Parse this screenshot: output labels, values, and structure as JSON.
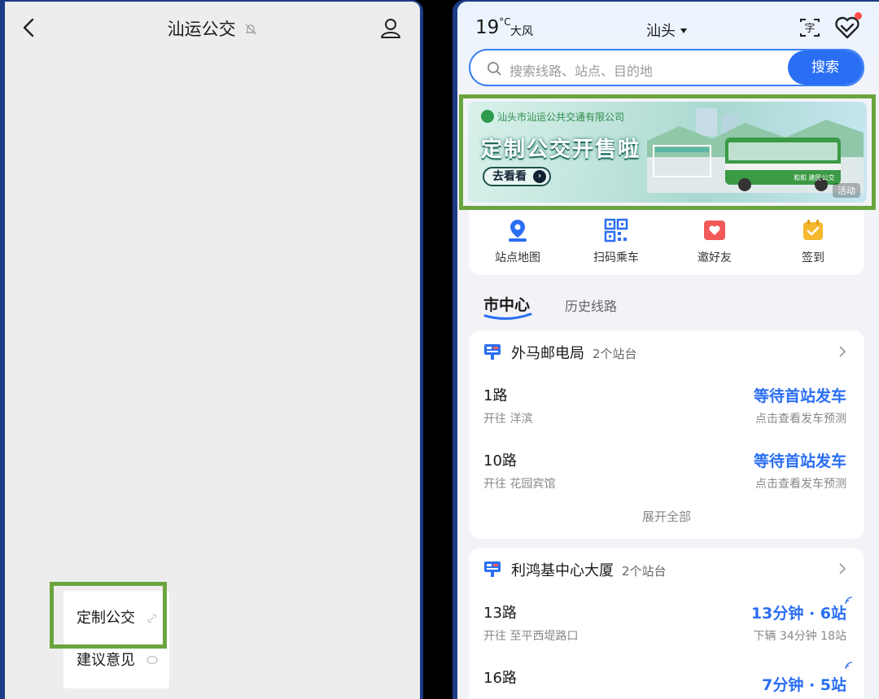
{
  "left": {
    "title": "汕运公交",
    "menu": [
      {
        "label": "定制公交"
      },
      {
        "label": "建议意见"
      }
    ]
  },
  "right": {
    "weather": {
      "temp": "19",
      "unit": "°C",
      "desc": "大风"
    },
    "city": "汕头",
    "search": {
      "placeholder": "搜索线路、站点、目的地",
      "button": "搜索"
    },
    "banner": {
      "company": "汕头市汕运公共交通有限公司",
      "headline": "定制公交开售啦",
      "cta": "去看看",
      "tag": "活动",
      "bus_text": "和和 建民公交"
    },
    "quick": [
      {
        "label": "站点地图",
        "icon": "map-pin-icon"
      },
      {
        "label": "扫码乘车",
        "icon": "qr-code-icon"
      },
      {
        "label": "邀好友",
        "icon": "invite-icon"
      },
      {
        "label": "签到",
        "icon": "checkin-icon"
      }
    ],
    "tabs": {
      "active": "市中心",
      "inactive": "历史线路"
    },
    "stops": [
      {
        "name": "外马邮电局",
        "count": "2个站台",
        "routes": [
          {
            "name": "1路",
            "dir": "开往 洋滨",
            "status": "等待首站发车",
            "sub": "点击查看发车预测"
          },
          {
            "name": "10路",
            "dir": "开往 花园宾馆",
            "status": "等待首站发车",
            "sub": "点击查看发车预测"
          }
        ],
        "expand": "展开全部"
      },
      {
        "name": "利鸿基中心大厦",
        "count": "2个站台",
        "routes": [
          {
            "name": "13路",
            "dir": "开往 至平西堤路口",
            "status": "13分钟 · 6站",
            "sub": "下辆 34分钟 18站"
          },
          {
            "name": "16路",
            "dir": "",
            "status": "7分钟 · 5站",
            "sub": ""
          }
        ]
      }
    ],
    "colors": {
      "accent": "#2a6ef3",
      "highlight": "#6aa43e",
      "frame": "#1d3c86"
    }
  }
}
